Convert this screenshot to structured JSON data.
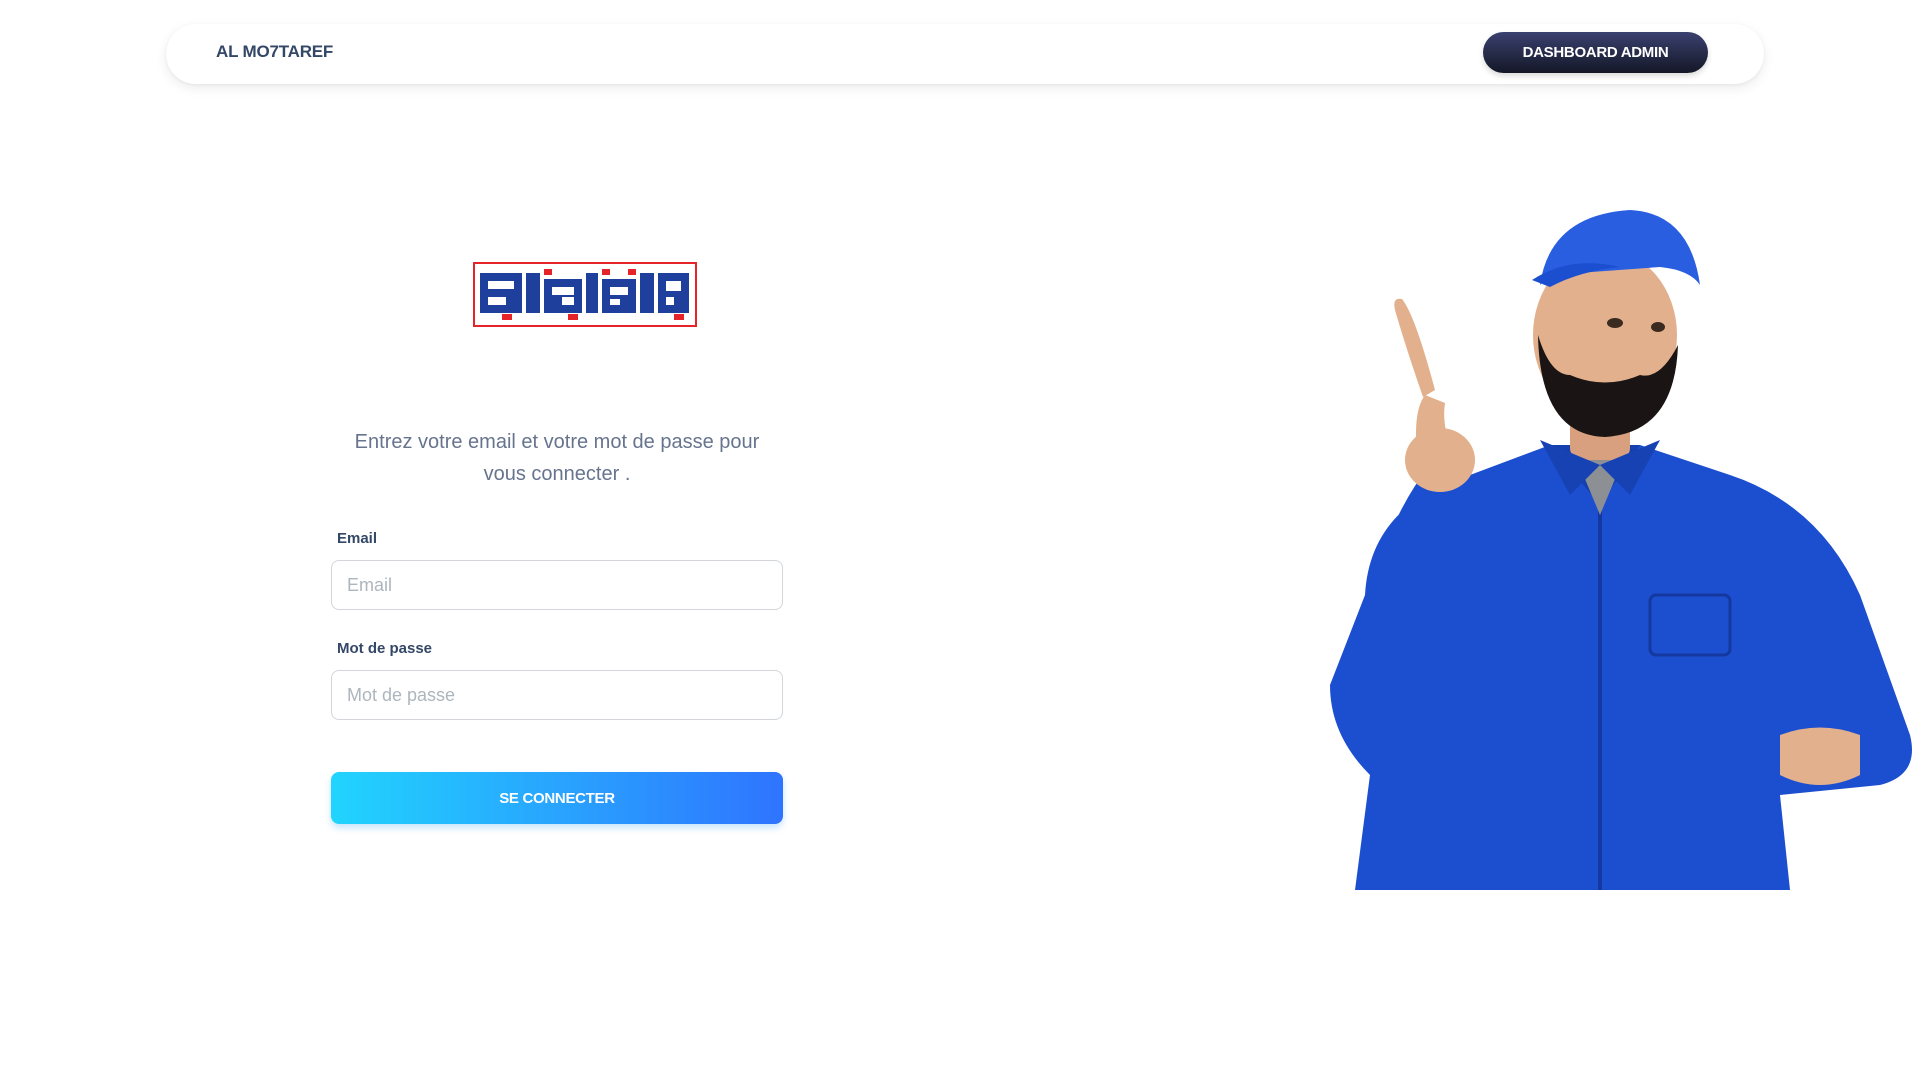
{
  "navbar": {
    "brand": "AL MO7TAREF",
    "dashboard_button": "DASHBOARD ADMIN"
  },
  "logo": {
    "name": "al-mohtaref-logo"
  },
  "login": {
    "intro": "Entrez votre email et votre mot de passe pour vous connecter .",
    "email_label": "Email",
    "email_placeholder": "Email",
    "email_value": "",
    "password_label": "Mot de passe",
    "password_placeholder": "Mot de passe",
    "password_value": "",
    "submit_label": "SE CONNECTER"
  },
  "hero": {
    "icon": "worker-pointing-illustration"
  },
  "colors": {
    "navy": "#344767",
    "button_dark": "#141727",
    "gradient_start": "#21d4fd",
    "gradient_end": "#2f74ff",
    "logo_blue": "#1f3f9c",
    "logo_red": "#e52329",
    "uniform_blue": "#1c4fd0"
  }
}
